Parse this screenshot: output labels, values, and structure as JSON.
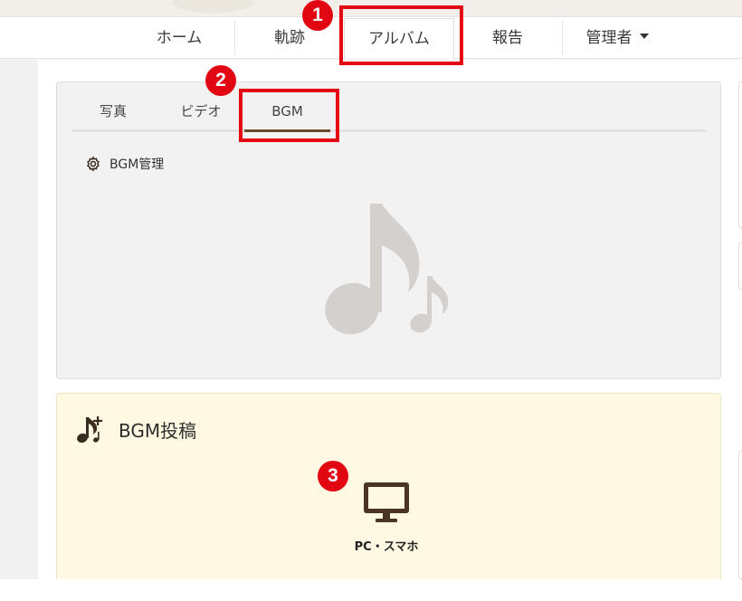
{
  "navbar": {
    "items": [
      {
        "label": "ホーム"
      },
      {
        "label": "軌跡"
      },
      {
        "label": "アルバム"
      },
      {
        "label": "報告"
      },
      {
        "label": "管理者"
      }
    ]
  },
  "album": {
    "tabs": [
      {
        "label": "写真"
      },
      {
        "label": "ビデオ"
      },
      {
        "label": "BGM"
      }
    ],
    "manage_label": "BGM管理"
  },
  "upload": {
    "title": "BGM投稿",
    "pc_label": "PC・スマホ"
  },
  "annotations": {
    "badge1": "1",
    "badge2": "2",
    "badge3": "3"
  },
  "colors": {
    "accent_brown": "#6b4a2a",
    "highlight_red": "#e30613",
    "upload_bg": "#fff8e2"
  }
}
